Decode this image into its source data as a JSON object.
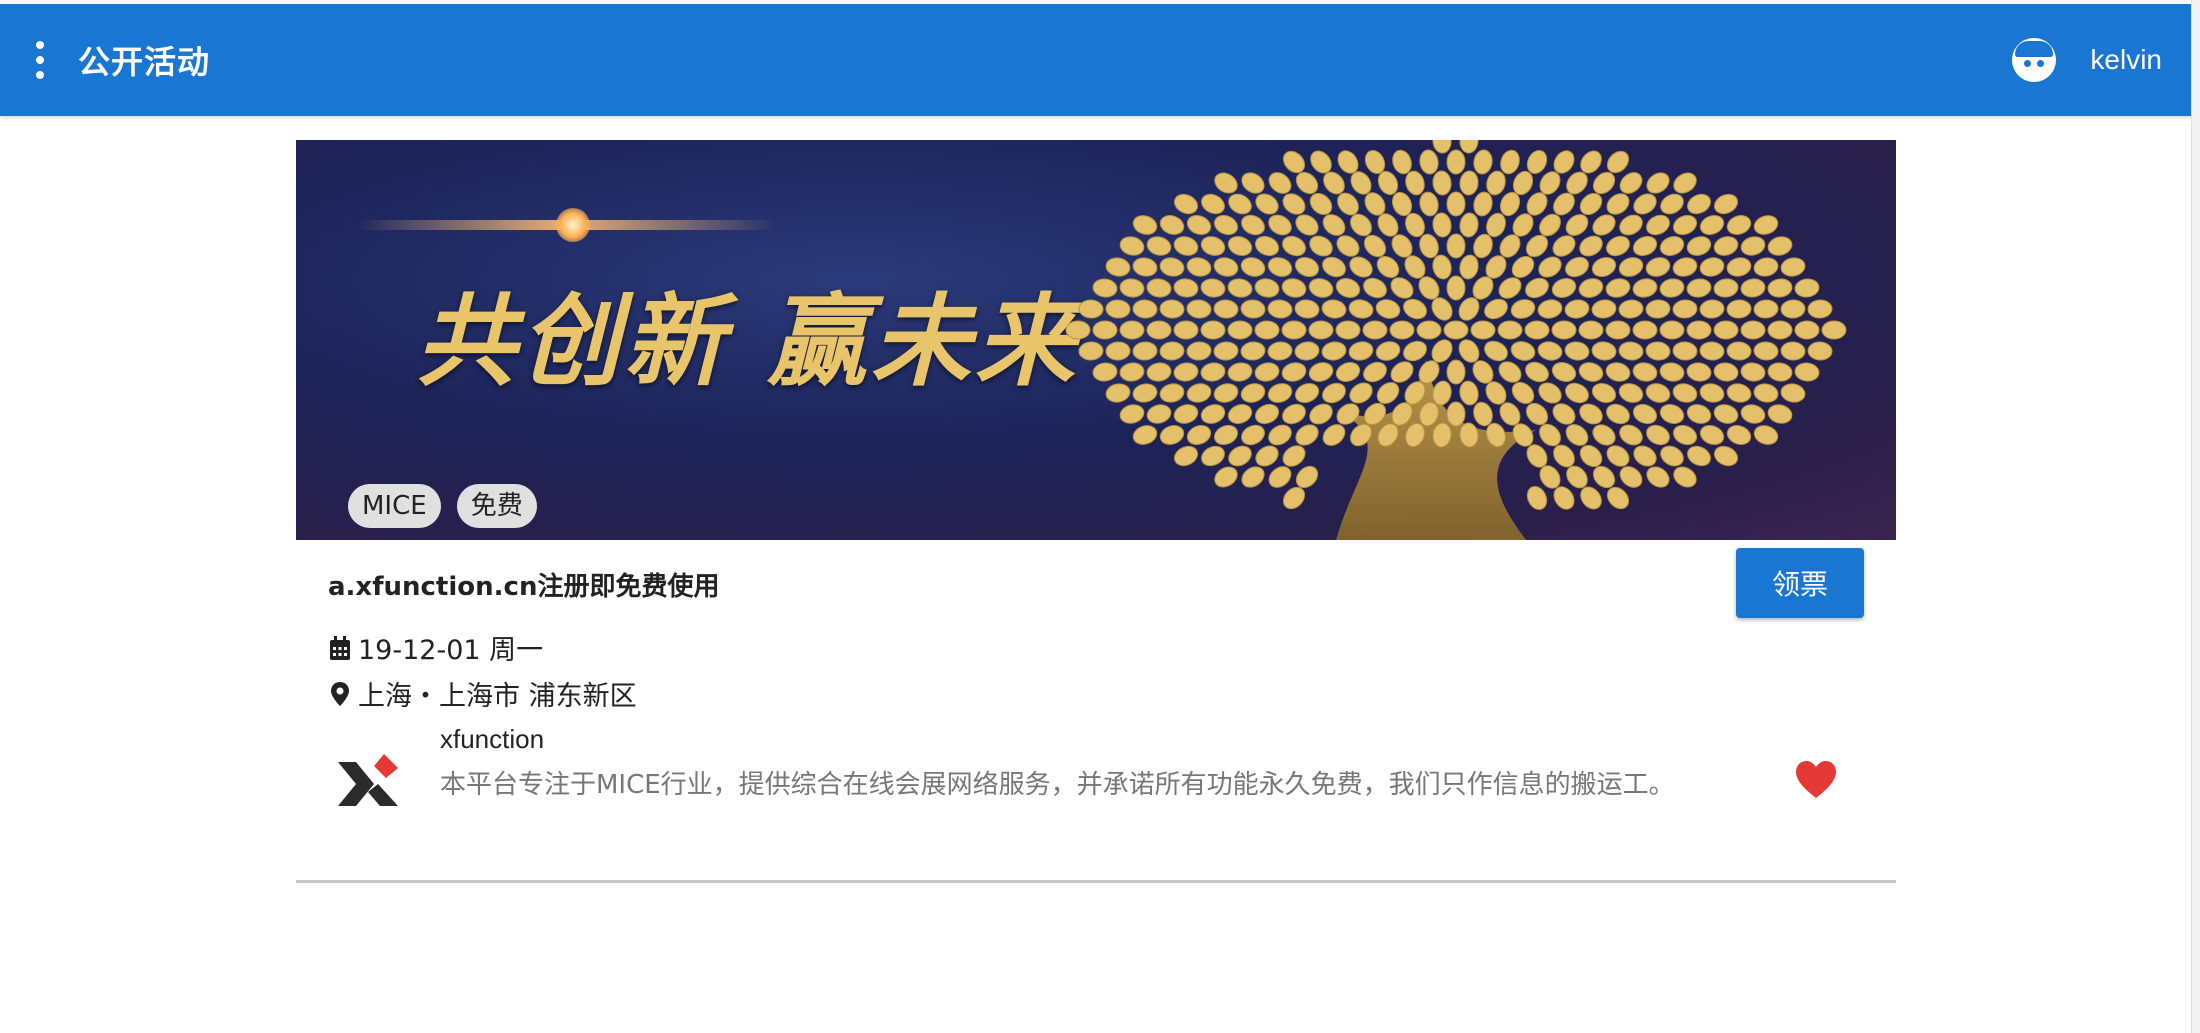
{
  "topbar": {
    "menu_icon": "more-vert-icon",
    "title": "公开活动",
    "avatar_icon": "user-avatar-icon",
    "username": "kelvin",
    "color": "#1976d2"
  },
  "event": {
    "banner_headline": "共创新 赢未来",
    "tags": [
      "MICE",
      "免费"
    ],
    "title": "a.xfunction.cn注册即免费使用",
    "claim_button": "领票",
    "date_icon": "calendar-icon",
    "date": "19-12-01 周一",
    "location_icon": "map-marker-icon",
    "location": "上海・上海市 浦东新区",
    "organizer": {
      "name": "xfunction",
      "description": "本平台专注于MICE行业，提供综合在线会展网络服务，并承诺所有功能永久免费，我们只作信息的搬运工。",
      "logo_icon": "xfunction-logo-icon"
    },
    "favorite_icon": "heart-icon",
    "favorite_color": "#e53935"
  }
}
